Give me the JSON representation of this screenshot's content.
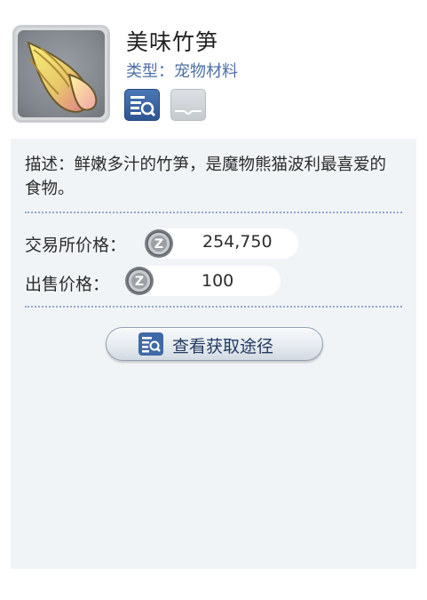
{
  "item": {
    "name": "美味竹笋",
    "type_text": "类型：宠物材料",
    "icon": "bamboo-shoot-icon",
    "badges": [
      {
        "icon": "item-lookup-icon",
        "active": true
      },
      {
        "icon": "card-slot-icon",
        "active": false
      }
    ]
  },
  "details": {
    "description": "描述：鲜嫩多汁的竹笋，是魔物熊猫波利最喜爱的食物。",
    "exchange_price": {
      "label": "交易所价格：",
      "value": "254,750",
      "currency_icon": "zeny-coin-icon"
    },
    "sell_price": {
      "label": "出售价格：",
      "value": "100",
      "currency_icon": "zeny-coin-icon"
    },
    "source_button": {
      "label": "查看获取途径",
      "icon": "search-list-icon"
    }
  },
  "colors": {
    "accent_blue": "#4e6fa6",
    "panel_bg": "#f1f4f7",
    "button_text": "#233b63"
  }
}
